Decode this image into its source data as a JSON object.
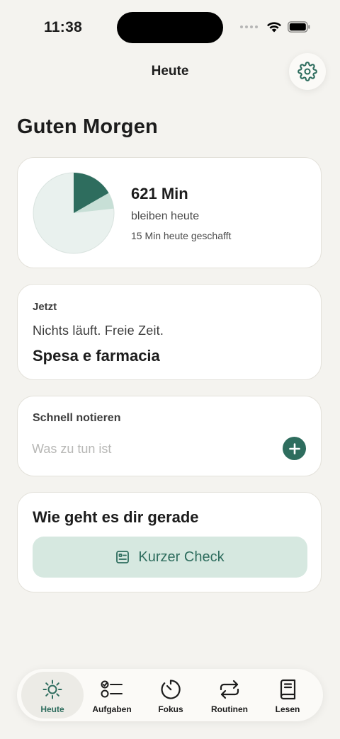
{
  "status_bar": {
    "time": "11:38"
  },
  "header": {
    "title": "Heute"
  },
  "greeting": "Guten Morgen",
  "progress_card": {
    "minutes_left": "621 Min",
    "remaining_label": "bleiben heute",
    "done_label": "15 Min heute geschafft",
    "pie": {
      "dark_fraction": 0.167,
      "light_fraction": 0.065,
      "colors": {
        "dark": "#2e6d5e",
        "light": "#c7dfd6",
        "base": "#e9f1ee"
      }
    }
  },
  "now_card": {
    "label": "Jetzt",
    "status": "Nichts läuft. Freie Zeit.",
    "task": "Spesa e farmacia"
  },
  "quick_note": {
    "label": "Schnell notieren",
    "placeholder": "Was zu tun ist"
  },
  "mood_card": {
    "title": "Wie geht es dir gerade",
    "button_label": "Kurzer Check"
  },
  "tabs": [
    {
      "label": "Heute",
      "icon": "sun-icon",
      "active": true
    },
    {
      "label": "Aufgaben",
      "icon": "checklist-icon",
      "active": false
    },
    {
      "label": "Fokus",
      "icon": "timer-icon",
      "active": false
    },
    {
      "label": "Routinen",
      "icon": "repeat-icon",
      "active": false
    },
    {
      "label": "Lesen",
      "icon": "book-icon",
      "active": false
    }
  ],
  "colors": {
    "accent": "#2e6d5e",
    "accent_light": "#d6e8e0",
    "background": "#f4f3ef"
  }
}
